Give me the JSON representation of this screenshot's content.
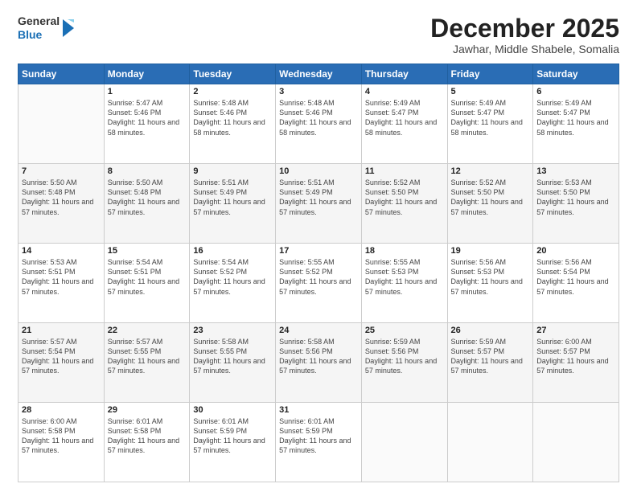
{
  "logo": {
    "general": "General",
    "blue": "Blue"
  },
  "header": {
    "title": "December 2025",
    "subtitle": "Jawhar, Middle Shabele, Somalia"
  },
  "weekdays": [
    "Sunday",
    "Monday",
    "Tuesday",
    "Wednesday",
    "Thursday",
    "Friday",
    "Saturday"
  ],
  "weeks": [
    [
      {
        "day": "",
        "empty": true
      },
      {
        "day": "1",
        "sunrise": "5:47 AM",
        "sunset": "5:46 PM",
        "daylight": "11 hours and 58 minutes."
      },
      {
        "day": "2",
        "sunrise": "5:48 AM",
        "sunset": "5:46 PM",
        "daylight": "11 hours and 58 minutes."
      },
      {
        "day": "3",
        "sunrise": "5:48 AM",
        "sunset": "5:46 PM",
        "daylight": "11 hours and 58 minutes."
      },
      {
        "day": "4",
        "sunrise": "5:49 AM",
        "sunset": "5:47 PM",
        "daylight": "11 hours and 58 minutes."
      },
      {
        "day": "5",
        "sunrise": "5:49 AM",
        "sunset": "5:47 PM",
        "daylight": "11 hours and 58 minutes."
      },
      {
        "day": "6",
        "sunrise": "5:49 AM",
        "sunset": "5:47 PM",
        "daylight": "11 hours and 58 minutes."
      }
    ],
    [
      {
        "day": "7",
        "sunrise": "5:50 AM",
        "sunset": "5:48 PM",
        "daylight": "11 hours and 57 minutes."
      },
      {
        "day": "8",
        "sunrise": "5:50 AM",
        "sunset": "5:48 PM",
        "daylight": "11 hours and 57 minutes."
      },
      {
        "day": "9",
        "sunrise": "5:51 AM",
        "sunset": "5:49 PM",
        "daylight": "11 hours and 57 minutes."
      },
      {
        "day": "10",
        "sunrise": "5:51 AM",
        "sunset": "5:49 PM",
        "daylight": "11 hours and 57 minutes."
      },
      {
        "day": "11",
        "sunrise": "5:52 AM",
        "sunset": "5:50 PM",
        "daylight": "11 hours and 57 minutes."
      },
      {
        "day": "12",
        "sunrise": "5:52 AM",
        "sunset": "5:50 PM",
        "daylight": "11 hours and 57 minutes."
      },
      {
        "day": "13",
        "sunrise": "5:53 AM",
        "sunset": "5:50 PM",
        "daylight": "11 hours and 57 minutes."
      }
    ],
    [
      {
        "day": "14",
        "sunrise": "5:53 AM",
        "sunset": "5:51 PM",
        "daylight": "11 hours and 57 minutes."
      },
      {
        "day": "15",
        "sunrise": "5:54 AM",
        "sunset": "5:51 PM",
        "daylight": "11 hours and 57 minutes."
      },
      {
        "day": "16",
        "sunrise": "5:54 AM",
        "sunset": "5:52 PM",
        "daylight": "11 hours and 57 minutes."
      },
      {
        "day": "17",
        "sunrise": "5:55 AM",
        "sunset": "5:52 PM",
        "daylight": "11 hours and 57 minutes."
      },
      {
        "day": "18",
        "sunrise": "5:55 AM",
        "sunset": "5:53 PM",
        "daylight": "11 hours and 57 minutes."
      },
      {
        "day": "19",
        "sunrise": "5:56 AM",
        "sunset": "5:53 PM",
        "daylight": "11 hours and 57 minutes."
      },
      {
        "day": "20",
        "sunrise": "5:56 AM",
        "sunset": "5:54 PM",
        "daylight": "11 hours and 57 minutes."
      }
    ],
    [
      {
        "day": "21",
        "sunrise": "5:57 AM",
        "sunset": "5:54 PM",
        "daylight": "11 hours and 57 minutes."
      },
      {
        "day": "22",
        "sunrise": "5:57 AM",
        "sunset": "5:55 PM",
        "daylight": "11 hours and 57 minutes."
      },
      {
        "day": "23",
        "sunrise": "5:58 AM",
        "sunset": "5:55 PM",
        "daylight": "11 hours and 57 minutes."
      },
      {
        "day": "24",
        "sunrise": "5:58 AM",
        "sunset": "5:56 PM",
        "daylight": "11 hours and 57 minutes."
      },
      {
        "day": "25",
        "sunrise": "5:59 AM",
        "sunset": "5:56 PM",
        "daylight": "11 hours and 57 minutes."
      },
      {
        "day": "26",
        "sunrise": "5:59 AM",
        "sunset": "5:57 PM",
        "daylight": "11 hours and 57 minutes."
      },
      {
        "day": "27",
        "sunrise": "6:00 AM",
        "sunset": "5:57 PM",
        "daylight": "11 hours and 57 minutes."
      }
    ],
    [
      {
        "day": "28",
        "sunrise": "6:00 AM",
        "sunset": "5:58 PM",
        "daylight": "11 hours and 57 minutes."
      },
      {
        "day": "29",
        "sunrise": "6:01 AM",
        "sunset": "5:58 PM",
        "daylight": "11 hours and 57 minutes."
      },
      {
        "day": "30",
        "sunrise": "6:01 AM",
        "sunset": "5:59 PM",
        "daylight": "11 hours and 57 minutes."
      },
      {
        "day": "31",
        "sunrise": "6:01 AM",
        "sunset": "5:59 PM",
        "daylight": "11 hours and 57 minutes."
      },
      {
        "day": "",
        "empty": true
      },
      {
        "day": "",
        "empty": true
      },
      {
        "day": "",
        "empty": true
      }
    ]
  ],
  "labels": {
    "sunrise": "Sunrise:",
    "sunset": "Sunset:",
    "daylight": "Daylight:"
  }
}
